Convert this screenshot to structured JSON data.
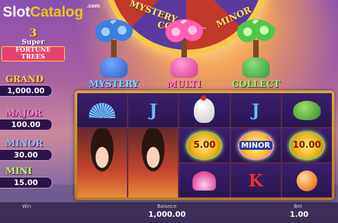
{
  "logo": {
    "slot": "Slot",
    "catalog": "Catalog",
    "com": ".com"
  },
  "game_title": {
    "number": "3",
    "line1": "Super",
    "line2": "FORTUNE TREES"
  },
  "wheel_labels": [
    "MYSTERY",
    "COLLECT",
    "MINOR"
  ],
  "jackpots": [
    {
      "name": "GRAND",
      "value": "1,000.00",
      "color": "#ffd23f"
    },
    {
      "name": "MAJOR",
      "value": "100.00",
      "color": "#ff7ad0"
    },
    {
      "name": "MINOR",
      "value": "30.00",
      "color": "#8fb8ff"
    },
    {
      "name": "MINI",
      "value": "15.00",
      "color": "#b6f26a"
    }
  ],
  "trees": [
    {
      "label": "MYSTERY",
      "label_color": "#7fd6ff",
      "crown": "#3b7fe0",
      "pot": "#2f5fc2"
    },
    {
      "label": "MULTI",
      "label_color": "#ff7ad0",
      "crown": "#ff5fb0",
      "pot": "#d63a8a"
    },
    {
      "label": "COLLECT",
      "label_color": "#9ef06a",
      "crown": "#4fc84a",
      "pot": "#2f9a3a"
    }
  ],
  "reels": {
    "coin_left": "5.00",
    "coin_minor": "MINOR",
    "coin_right": "10.00",
    "letter_j": "J",
    "letter_k": "K"
  },
  "bottom": {
    "win_label": "Win",
    "win_value": "",
    "balance_label": "Balance",
    "balance_value": "1,000.00",
    "bet_label": "Bet",
    "bet_value": "1.00"
  }
}
